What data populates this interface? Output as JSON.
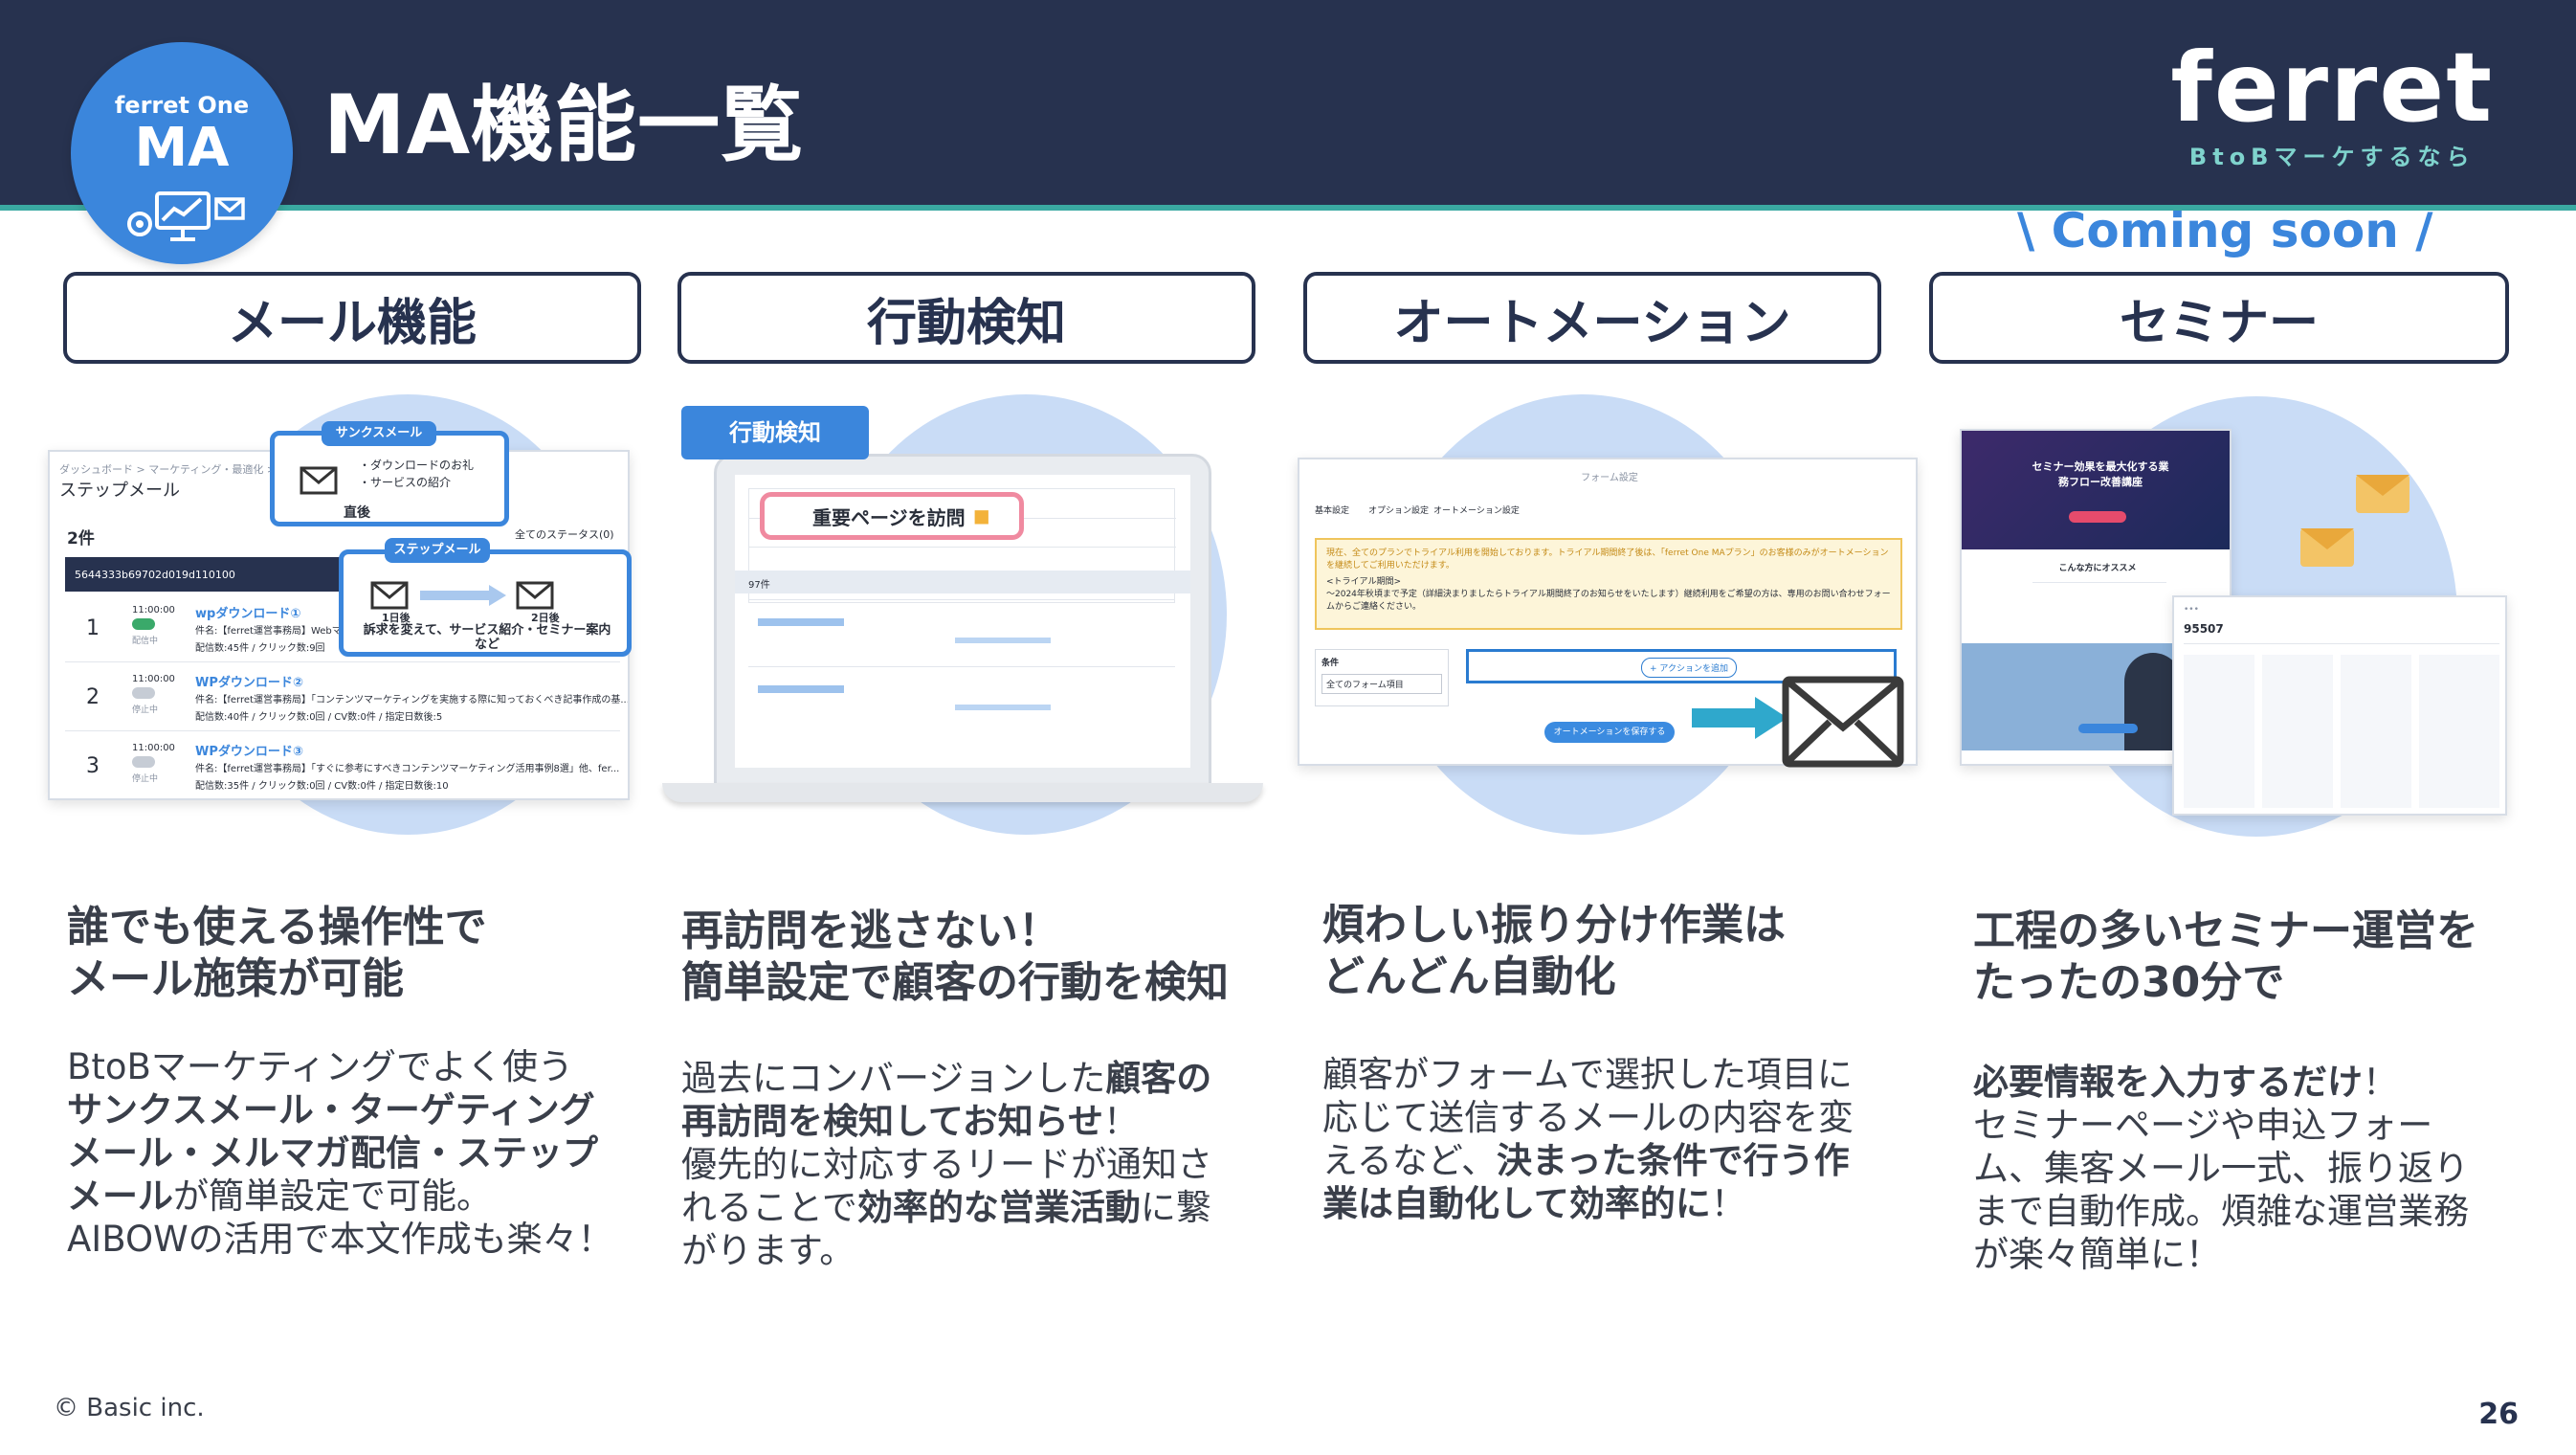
{
  "header": {
    "badge_top": "ferret One",
    "badge_main": "MA",
    "title": "MA機能一覧",
    "logo_main": "ferret",
    "logo_sub": "BtoBマーケするなら"
  },
  "coming_soon": "\\ Coming soon /",
  "categories": [
    "メール機能",
    "行動検知",
    "オートメーション",
    "セミナー"
  ],
  "mail_shot": {
    "breadcrumb": "ダッシュボード > マーケティング・最適化 > メール",
    "title": "ステップメール",
    "count": "2件",
    "filter": "全てのステータス(0)",
    "id_bar": "5644333b69702d019d110100",
    "callout1_tag": "サンクスメール",
    "callout1_lines": [
      "・ダウンロードのお礼",
      "・サービスの紹介"
    ],
    "callout1_when": "直後",
    "callout2_tag": "ステップメール",
    "callout2_day1": "1日後",
    "callout2_day2": "2日後",
    "callout2_text": "訴求を変えて、サービス紹介・セミナー案内など",
    "rows": [
      {
        "num": "1",
        "time": "11:00:00",
        "status": "配信中",
        "name": "wpダウンロード①",
        "subject": "件名:【ferret運営事務局】Webマ...",
        "stats": "配信数:45件 / クリック数:9回"
      },
      {
        "num": "2",
        "time": "11:00:00",
        "status": "停止中",
        "name": "WPダウンロード②",
        "subject": "件名:【ferret運営事務局】「コンテンツマーケティングを実施する際に知っておくべき記事作成の基...",
        "stats": "配信数:40件 / クリック数:0回 / CV数:0件 / 指定日数後:5"
      },
      {
        "num": "3",
        "time": "11:00:00",
        "status": "停止中",
        "name": "WPダウンロード③",
        "subject": "件名:【ferret運営事務局】「すぐに参考にすべきコンテンツマーケティング活用事例8選」他、fer...",
        "stats": "配信数:35件 / クリック数:0回 / CV数:0件 / 指定日数後:10"
      }
    ]
  },
  "detect_shot": {
    "tag": "行動検知",
    "bubble": "重要ページを訪問",
    "count": "97件"
  },
  "auto_shot": {
    "title": "フォーム設定",
    "tabs": [
      "基本設定",
      "オプション設定",
      "オートメーション設定"
    ],
    "notice": "現在、全てのプランでトライアル利用を開始しております。トライアル期間終了後は、「ferret One MAプラン」のお客様のみがオートメーションを継続してご利用いただけます。",
    "trial_label": "<トライアル期間>",
    "trial_text": "〜2024年秋頃まで予定（詳細決まりましたらトライアル期間終了のお知らせをいたします）継続利用をご希望の方は、専用のお問い合わせフォームからご連絡ください。",
    "condition_label": "条件",
    "condition_select": "全てのフォーム項目",
    "add_action": "+ アクションを追加",
    "save_button": "オートメーションを保存する"
  },
  "seminar_shot": {
    "banner": "セミナー効果を最大化する業務フロー改善講座",
    "recommend": "こんな方にオススメ",
    "count": "95507"
  },
  "columns": [
    {
      "heading": [
        "誰でも使える操作性で",
        "メール施策が可能"
      ],
      "desc": [
        {
          "t": "BtoBマーケティングでよく使う",
          "b": false
        },
        {
          "t": "サンクスメール・ターゲティング",
          "b": true
        },
        {
          "t": "メール・メルマガ配信・ステップ",
          "b": true
        },
        {
          "t": "メール",
          "b": true
        },
        {
          "t": "が簡単設定で可能。",
          "b": false
        },
        {
          "t": "AIBOWの活用で本文作成も楽々！",
          "b": false
        }
      ]
    },
    {
      "heading": [
        "再訪問を逃さない！",
        "簡単設定で顧客の行動を検知"
      ],
      "desc": [
        {
          "t": "過去にコンバージョンした",
          "b": false
        },
        {
          "t": "顧客の",
          "b": true
        },
        {
          "t": "再訪問を検知してお知らせ",
          "b": true
        },
        {
          "t": "！",
          "b": false
        },
        {
          "t": "優先的に対応するリードが通知さ",
          "b": false
        },
        {
          "t": "れることで",
          "b": false
        },
        {
          "t": "効率的な営業活動",
          "b": true
        },
        {
          "t": "に繋",
          "b": false
        },
        {
          "t": "がります。",
          "b": false
        }
      ]
    },
    {
      "heading": [
        "煩わしい振り分け作業は",
        "どんどん自動化"
      ],
      "desc": [
        {
          "t": "顧客がフォームで選択した項目に",
          "b": false
        },
        {
          "t": "応じて送信するメールの内容を変",
          "b": false
        },
        {
          "t": "えるなど、",
          "b": false
        },
        {
          "t": "決まった条件で行う作",
          "b": true
        },
        {
          "t": "業は自動化して効率的に",
          "b": true
        },
        {
          "t": "！",
          "b": false
        }
      ]
    },
    {
      "heading": [
        "工程の多いセミナー運営を",
        "たったの30分で"
      ],
      "desc": [
        {
          "t": "必要情報を入力するだけ",
          "b": true
        },
        {
          "t": "！",
          "b": false
        },
        {
          "t": "セミナーページや申込フォー",
          "b": false
        },
        {
          "t": "ム、集客メール一式、振り返り",
          "b": false
        },
        {
          "t": "まで自動作成。煩雑な運営業務",
          "b": false
        },
        {
          "t": "が楽々簡単に！",
          "b": false
        }
      ]
    }
  ],
  "footer": {
    "copyright": "© Basic inc.",
    "page": "26"
  },
  "colors": {
    "navy": "#27324f",
    "teal": "#3aa9a1",
    "blue": "#3b86dc",
    "circle": "#c9dcf6"
  }
}
